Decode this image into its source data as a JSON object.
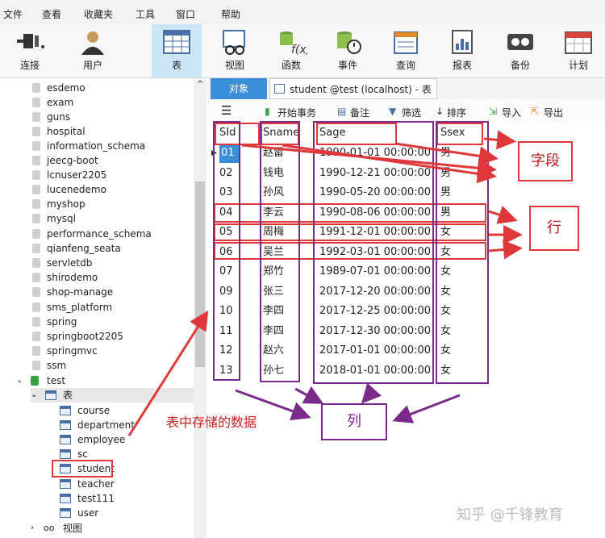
{
  "menu": [
    "文件",
    "查看",
    "收藏夹",
    "工具",
    "窗口",
    "帮助"
  ],
  "toolbar": [
    {
      "label": "连接",
      "icon": "plug-icon"
    },
    {
      "label": "用户",
      "icon": "user-icon"
    },
    {
      "label": "表",
      "icon": "table-icon"
    },
    {
      "label": "视图",
      "icon": "view-icon"
    },
    {
      "label": "函数",
      "icon": "function-icon"
    },
    {
      "label": "事件",
      "icon": "event-icon"
    },
    {
      "label": "查询",
      "icon": "query-icon"
    },
    {
      "label": "报表",
      "icon": "report-icon"
    },
    {
      "label": "备份",
      "icon": "backup-icon"
    },
    {
      "label": "计划",
      "icon": "schedule-icon"
    }
  ],
  "sidebar": {
    "databases": [
      "esdemo",
      "exam",
      "guns",
      "hospital",
      "information_schema",
      "jeecg-boot",
      "lcnuser2205",
      "lucenedemo",
      "myshop",
      "mysql",
      "performance_schema",
      "qianfeng_seata",
      "servletdb",
      "shirodemo",
      "shop-manage",
      "sms_platform",
      "spring",
      "springboot2205",
      "springmvc",
      "ssm"
    ],
    "open_db": "test",
    "tables_folder": "表",
    "tables": [
      "course",
      "department",
      "employee",
      "sc",
      "student",
      "teacher",
      "test111",
      "user"
    ],
    "views_folder": "视图"
  },
  "tabs": {
    "object": "对象",
    "main": "student @test (localhost) - 表"
  },
  "subtoolbar": {
    "begin_tx": "开始事务",
    "note": "备注",
    "filter": "筛选",
    "sort": "排序",
    "import": "导入",
    "export": "导出"
  },
  "table": {
    "columns": [
      "SId",
      "Sname",
      "Sage",
      "Ssex"
    ],
    "rows": [
      [
        "01",
        "赵雷",
        "1990-01-01 00:00:00",
        "男"
      ],
      [
        "02",
        "钱电",
        "1990-12-21 00:00:00",
        "男"
      ],
      [
        "03",
        "孙风",
        "1990-05-20 00:00:00",
        "男"
      ],
      [
        "04",
        "李云",
        "1990-08-06 00:00:00",
        "男"
      ],
      [
        "05",
        "周梅",
        "1991-12-01 00:00:00",
        "女"
      ],
      [
        "06",
        "吴兰",
        "1992-03-01 00:00:00",
        "女"
      ],
      [
        "07",
        "郑竹",
        "1989-07-01 00:00:00",
        "女"
      ],
      [
        "09",
        "张三",
        "2017-12-20 00:00:00",
        "女"
      ],
      [
        "10",
        "李四",
        "2017-12-25 00:00:00",
        "女"
      ],
      [
        "11",
        "李四",
        "2017-12-30 00:00:00",
        "女"
      ],
      [
        "12",
        "赵六",
        "2017-01-01 00:00:00",
        "女"
      ],
      [
        "13",
        "孙七",
        "2018-01-01 00:00:00",
        "女"
      ]
    ]
  },
  "annotations": {
    "field": "字段",
    "row": "行",
    "column": "列",
    "data": "表中存储的数据"
  },
  "watermark": "知乎 @千锋教育",
  "colors": {
    "accent": "#3b8ed8",
    "annot_red": "#e0383a",
    "annot_purple": "#7a2a8a"
  }
}
